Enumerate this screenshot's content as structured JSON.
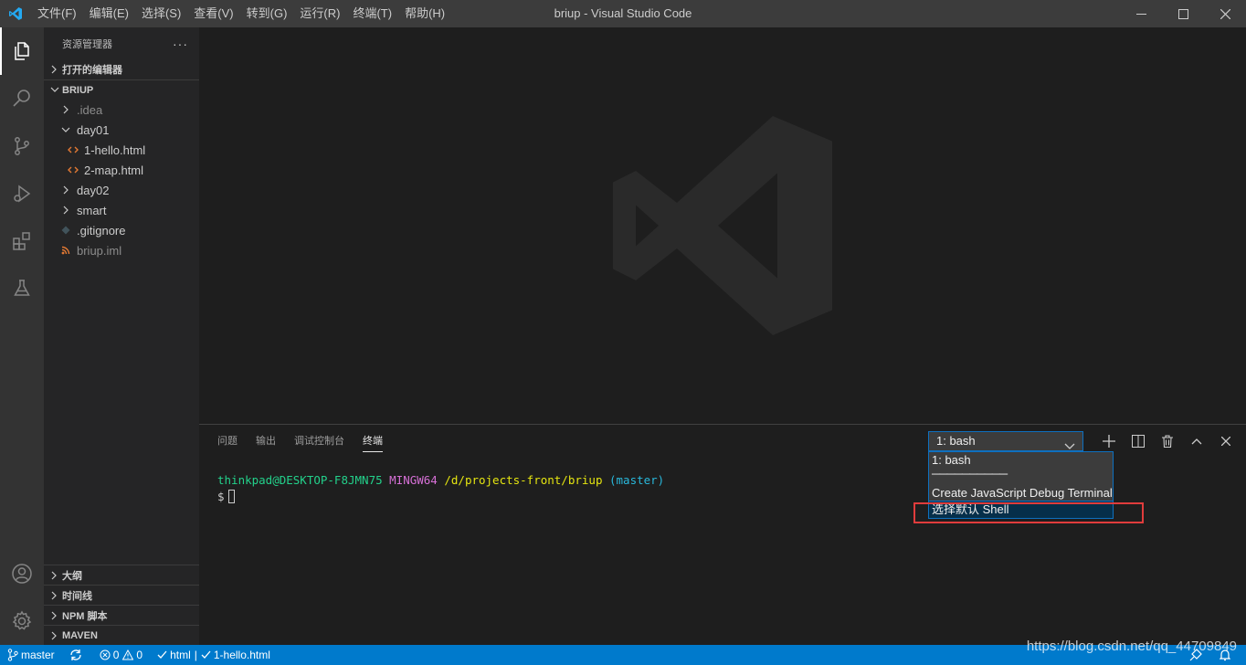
{
  "titlebar": {
    "menu": [
      "文件(F)",
      "编辑(E)",
      "选择(S)",
      "查看(V)",
      "转到(G)",
      "运行(R)",
      "终端(T)",
      "帮助(H)"
    ],
    "title": "briup - Visual Studio Code"
  },
  "activitybar": {
    "items": [
      "files-icon",
      "search-icon",
      "source-control-icon",
      "run-debug-icon",
      "extensions-icon",
      "testing-icon"
    ],
    "bottom": [
      "account-icon",
      "settings-gear-icon"
    ]
  },
  "sidebar": {
    "title": "资源管理器",
    "more": "···",
    "open_editors": "打开的编辑器",
    "workspace": "BRIUP",
    "tree": [
      {
        "label": ".idea",
        "type": "folder",
        "expanded": false,
        "muted": true
      },
      {
        "label": "day01",
        "type": "folder",
        "expanded": true
      },
      {
        "label": "1-hello.html",
        "type": "html"
      },
      {
        "label": "2-map.html",
        "type": "html"
      },
      {
        "label": "day02",
        "type": "folder",
        "expanded": false
      },
      {
        "label": "smart",
        "type": "folder",
        "expanded": false
      },
      {
        "label": ".gitignore",
        "type": "git"
      },
      {
        "label": "briup.iml",
        "type": "rss",
        "muted": true
      }
    ],
    "bottom_sections": [
      "大纲",
      "时间线",
      "NPM 脚本",
      "MAVEN"
    ]
  },
  "panel": {
    "tabs": [
      "问题",
      "输出",
      "调试控制台",
      "终端"
    ],
    "active_tab": "终端",
    "terminal_select": "1: bash",
    "dropdown": {
      "items": [
        "1: bash",
        "──────────",
        "Create JavaScript Debug Terminal",
        "选择默认 Shell"
      ]
    },
    "terminal": {
      "user": "thinkpad@DESKTOP-F8JMN75",
      "env": "MINGW64",
      "path": "/d/projects-front/briup",
      "branch": "(master)",
      "prompt": "$"
    }
  },
  "statusbar": {
    "branch": "master",
    "errors": "0",
    "warnings": "0",
    "check_html": "html",
    "check_file": "1-hello.html",
    "separator": "|"
  },
  "watermark_url": "https://blog.csdn.net/qq_44709849",
  "colors": {
    "accent": "#007acc",
    "highlight_box": "#e03c3c",
    "vscode_blue": "#23a9f2"
  }
}
